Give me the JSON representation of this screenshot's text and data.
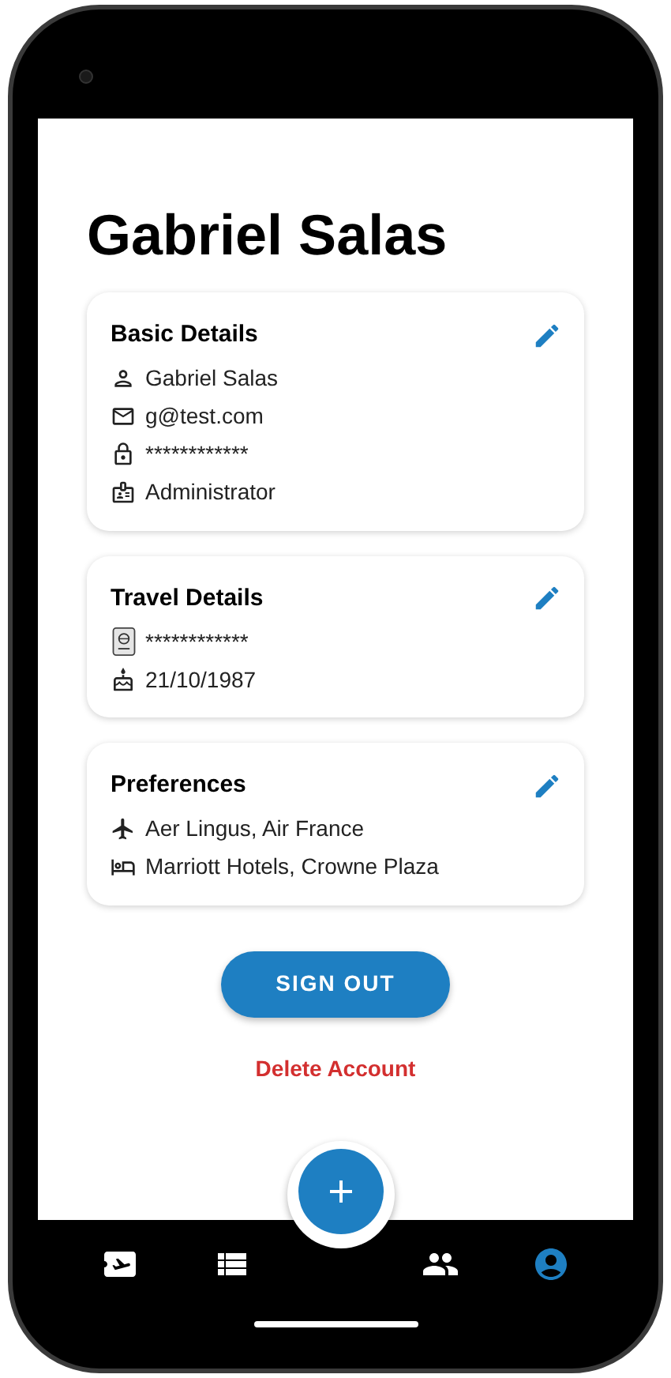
{
  "profile_name": "Gabriel Salas",
  "cards": [
    {
      "title": "Basic Details",
      "rows": [
        {
          "kind": "person",
          "text": "Gabriel Salas"
        },
        {
          "kind": "email",
          "text": "g@test.com"
        },
        {
          "kind": "password",
          "text": "************"
        },
        {
          "kind": "role",
          "text": "Administrator"
        }
      ]
    },
    {
      "title": "Travel Details",
      "rows": [
        {
          "kind": "passport",
          "text": "************"
        },
        {
          "kind": "birthday",
          "text": "21/10/1987"
        }
      ]
    },
    {
      "title": "Preferences",
      "rows": [
        {
          "kind": "airlines",
          "text": "Aer Lingus, Air France"
        },
        {
          "kind": "hotels",
          "text": "Marriott Hotels, Crowne Plaza"
        }
      ]
    }
  ],
  "sign_out_button": "SIGN OUT",
  "delete_account_link": "Delete Account",
  "nav": [
    {
      "kind": "trips",
      "selected": false
    },
    {
      "kind": "list",
      "selected": false
    },
    {
      "kind": "people",
      "selected": false
    },
    {
      "kind": "profile",
      "selected": true
    }
  ]
}
